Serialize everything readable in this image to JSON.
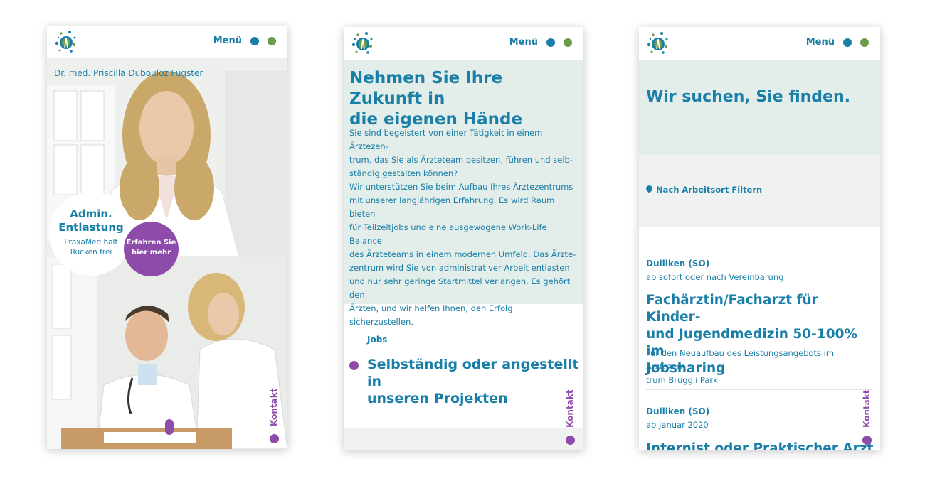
{
  "header": {
    "menu_label": "Menü",
    "contact_label": "Kontakt"
  },
  "colors": {
    "primary": "#1a7fa8",
    "accent_purple": "#8e4caa",
    "accent_green": "#6e9a4c",
    "panel_teal": "#e3ede9"
  },
  "screen1": {
    "doctor_name": "Dr. med. Priscilla Dubouloz Fugster",
    "badge_title_line1": "Admin.",
    "badge_title_line2": "Entlastung",
    "badge_sub_line1": "PraxaMed hält",
    "badge_sub_line2": "Rücken frei",
    "cta_line1": "Erfahren Sie",
    "cta_line2": "hier mehr"
  },
  "screen2": {
    "title_line1": "Nehmen Sie Ihre Zukunft in",
    "title_line2": "die eigenen Hände",
    "para1": [
      "Sie sind begeistert von einer Tätigkeit in einem Ärztezen-",
      "trum, das Sie als Ärzteteam besitzen, führen und selb-",
      "ständig gestalten können?"
    ],
    "para2": [
      "Wir unterstützen Sie beim Aufbau Ihres Ärztezentrums",
      "mit unserer langjährigen Erfahrung. Es wird Raum bieten",
      "für Teilzeitjobs und eine ausgewogene Work-Life Balance",
      "des Ärzteteams in einem modernen Umfeld. Das Ärzte-",
      "zentrum wird Sie von administrativer Arbeit entlasten",
      "und nur sehr geringe Startmittel verlangen. Es gehört den",
      "Ärzten, und wir helfen Ihnen, den Erfolg sicherzustellen."
    ],
    "jobs_label": "Jobs",
    "jobs_title_line1": "Selbständig oder angestellt in",
    "jobs_title_line2": "unseren Projekten"
  },
  "screen3": {
    "title": "Wir suchen, Sie finden.",
    "filter_label": "Nach Arbeitsort Filtern",
    "jobs": [
      {
        "location": "Dulliken (SO)",
        "date": "ab sofort oder nach Vereinbarung",
        "title_lines": [
          "Fachärztin/Facharzt für Kinder-",
          "und Jugendmedizin 50-100% im",
          "Jobsharing"
        ],
        "desc_lines": [
          "Für den Neuaufbau des Leistungsangebots im Ärztezen-",
          "trum Brüggli Park"
        ]
      },
      {
        "location": "Dulliken (SO)",
        "date": "ab Januar 2020",
        "title_lines": [
          "Internist oder Praktischer Arzt"
        ]
      }
    ]
  }
}
